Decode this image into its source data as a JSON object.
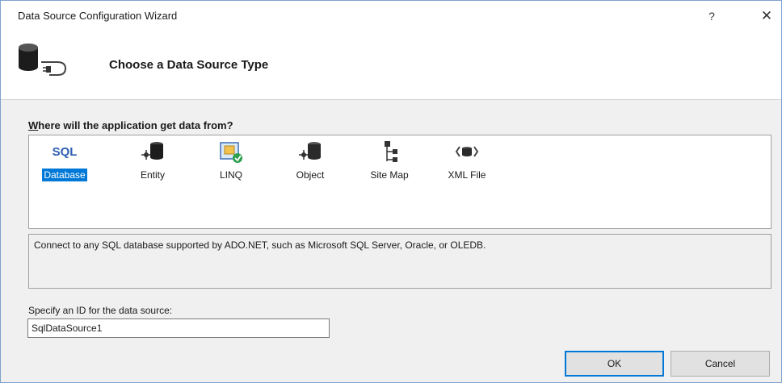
{
  "window": {
    "title": "Data Source Configuration Wizard",
    "help_glyph": "?",
    "close_glyph": "✕"
  },
  "header": {
    "title": "Choose a Data Source Type",
    "icon": "database-connection-icon"
  },
  "source_types": {
    "prompt_prefix": "W",
    "prompt_rest": "here will the application get data from?",
    "selected": "Database",
    "items": [
      {
        "label": "Database",
        "icon": "sql-icon"
      },
      {
        "label": "Entity",
        "icon": "entity-icon"
      },
      {
        "label": "LINQ",
        "icon": "linq-icon"
      },
      {
        "label": "Object",
        "icon": "object-icon"
      },
      {
        "label": "Site Map",
        "icon": "site-map-icon"
      },
      {
        "label": "XML File",
        "icon": "xml-file-icon"
      }
    ]
  },
  "description": "Connect to any SQL database supported by ADO.NET, such as Microsoft SQL Server, Oracle, or OLEDB.",
  "id_field": {
    "label": "Specify an ID for the data source:",
    "value": "SqlDataSource1"
  },
  "buttons": {
    "ok": "OK",
    "cancel": "Cancel"
  },
  "colors": {
    "selection": "#0078d7",
    "window_border": "#7da2ce",
    "sql_text": "#2e5fb5"
  }
}
